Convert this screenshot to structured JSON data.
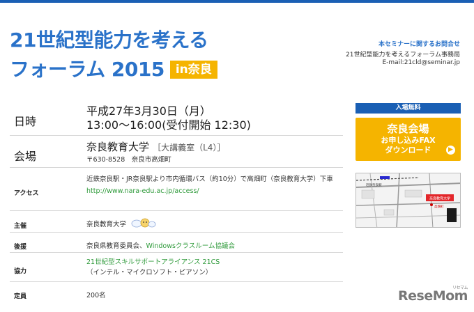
{
  "header": {
    "title_line1": "21世紀型能力を考える",
    "title_line2": "フォーラム 2015",
    "badge": "in奈良"
  },
  "contact": {
    "heading": "本セミナーに関するお問合せ",
    "office": "21世紀型能力を考えるフォーラム事務局",
    "email": "E-mail:21cld@seminar.jp"
  },
  "details": {
    "datetime_label": "日時",
    "datetime_value1": "平成27年3月30日（月）",
    "datetime_value2": "13:00〜16:00(受付開始 12:30)",
    "venue_label": "会場",
    "venue_name": "奈良教育大学",
    "venue_room": "［大講義室（L4）］",
    "venue_address": "〒630-8528　奈良市高畑町",
    "access_label": "アクセス",
    "access_text": "近鉄奈良駅・JR奈良駅より市内循環バス（約10分）で高畑町（奈良教育大学）下車",
    "access_url": "http://www.nara-edu.ac.jp/access/",
    "host_label": "主催",
    "host_value": "奈良教育大学",
    "support_label": "後援",
    "support_value1": "奈良県教育委員会、",
    "support_value2": "Windowsクラスルーム協議会",
    "coop_label": "協力",
    "coop_value1": "21世紀型スキルサポートアライアンス 21CS",
    "coop_value2": "（インテル・マイクロソフト・ピアソン）",
    "capacity_label": "定員",
    "capacity_value": "200名"
  },
  "sidebar": {
    "free_label": "入場無料",
    "btn_line1": "奈良会場",
    "btn_line2": "お申し込みFAX",
    "btn_line3": "ダウンロード",
    "map_station": "近鉄奈良駅",
    "map_university": "奈良教育大学",
    "map_bus": "高畑町"
  },
  "watermark": {
    "text": "ReseMom",
    "sub": "リセマム"
  },
  "colors": {
    "brand_blue": "#2a72c9",
    "navy": "#1a5fb4",
    "accent_yellow": "#f5b400",
    "link_green": "#2e9a3a"
  }
}
